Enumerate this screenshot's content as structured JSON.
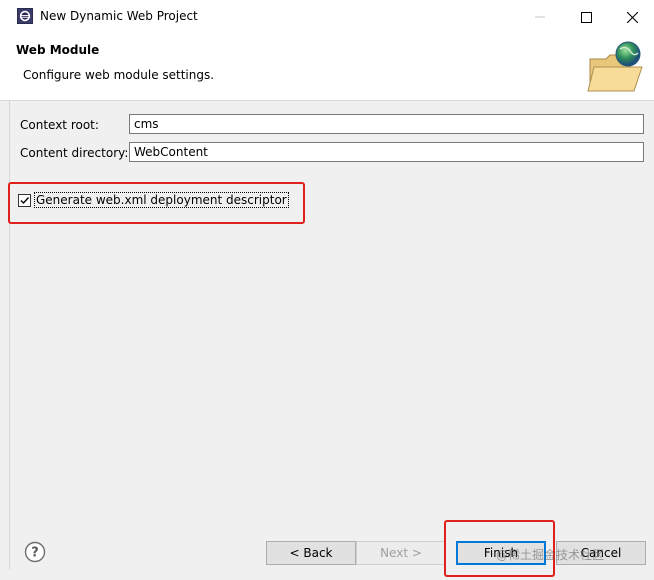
{
  "window": {
    "title": "New Dynamic Web Project",
    "controls": {
      "minimize": "minimize",
      "maximize": "maximize",
      "close": "close"
    }
  },
  "header": {
    "title": "Web Module",
    "description": "Configure web module settings."
  },
  "form": {
    "context_root": {
      "label": "Context root:",
      "value": "cms"
    },
    "content_directory": {
      "label": "Content directory:",
      "value": "WebContent"
    },
    "generate_descriptor": {
      "label": "Generate web.xml deployment descriptor",
      "checked": true
    }
  },
  "footer": {
    "back_label": "< Back",
    "next_label": "Next >",
    "finish_label": "Finish",
    "cancel_label": "Cancel"
  },
  "watermark": "@稀土掘金技术社区",
  "icons": [
    "eclipse-app-icon",
    "minimize-icon",
    "maximize-icon",
    "close-icon",
    "folder-globe-icon",
    "help-icon",
    "checkmark-icon"
  ],
  "colors": {
    "highlight": "#e0201b",
    "default_button_border": "#0078d7",
    "header_bg": "#ffffff",
    "body_bg": "#f0f0f0"
  }
}
